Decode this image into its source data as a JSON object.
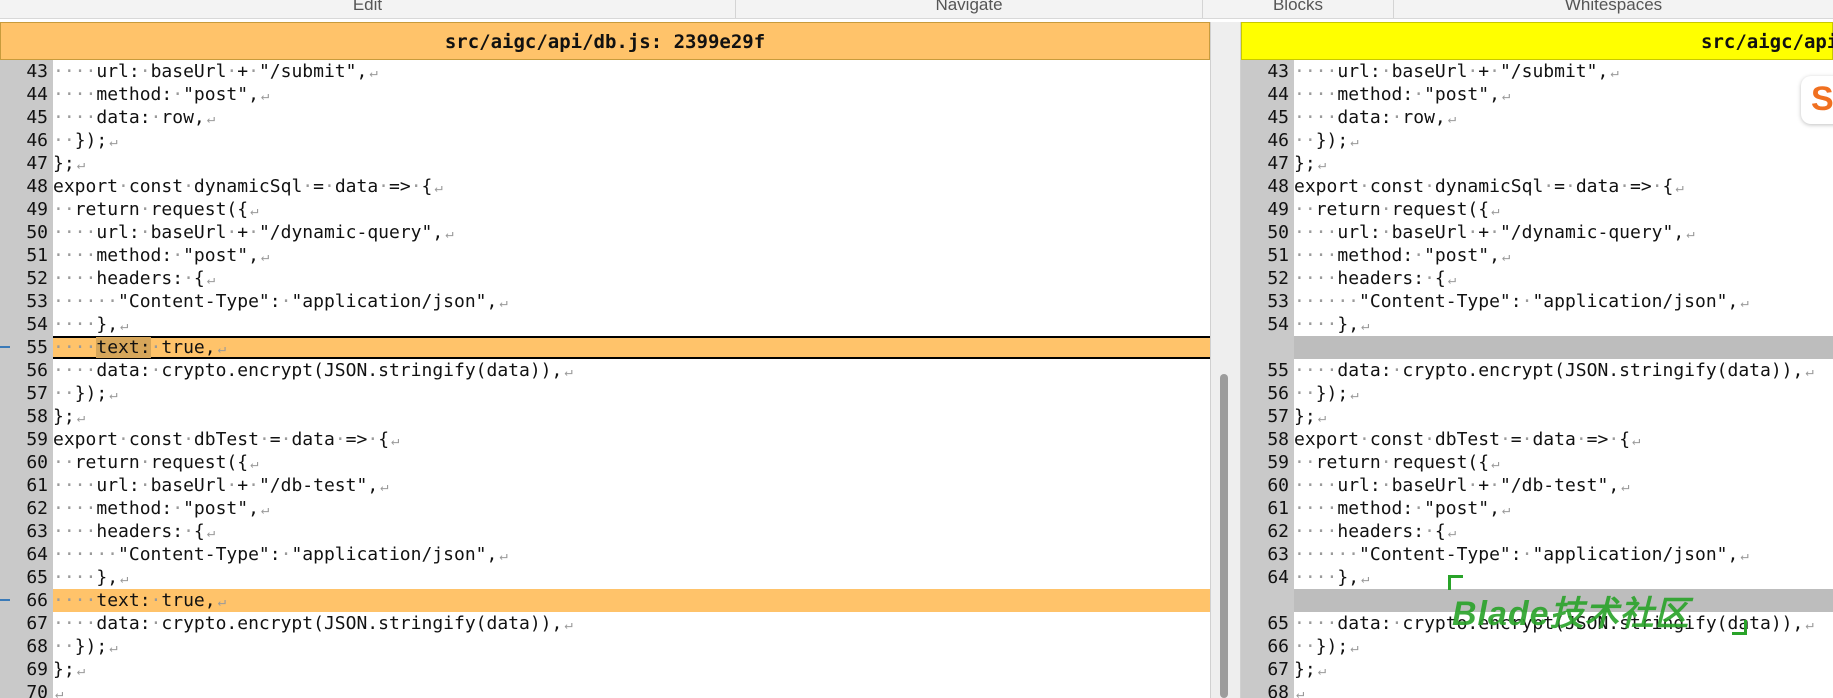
{
  "menu": [
    "Edit",
    "Navigate",
    "Blocks",
    "Whitespaces"
  ],
  "left_title": "src/aigc/api/db.js: 2399e29f",
  "right_title": "src/aigc/api",
  "watermark": "Blade技术社区",
  "logo_letter": "S",
  "colors": {
    "changed": "#ffc36a",
    "right_header": "#ffff00",
    "gutter": "#c9c9c9"
  },
  "left_lines": [
    {
      "n": "43",
      "t": "····url:·baseUrl·+·\"/submit\","
    },
    {
      "n": "44",
      "t": "····method:·\"post\","
    },
    {
      "n": "45",
      "t": "····data:·row,"
    },
    {
      "n": "46",
      "t": "··});"
    },
    {
      "n": "47",
      "t": "};"
    },
    {
      "n": "48",
      "t": "export·const·dynamicSql·=·data·=>·{"
    },
    {
      "n": "49",
      "t": "··return·request({"
    },
    {
      "n": "50",
      "t": "····url:·baseUrl·+·\"/dynamic-query\","
    },
    {
      "n": "51",
      "t": "····method:·\"post\","
    },
    {
      "n": "52",
      "t": "····headers:·{"
    },
    {
      "n": "53",
      "t": "······\"Content-Type\":·\"application/json\","
    },
    {
      "n": "54",
      "t": "····},"
    },
    {
      "n": "55",
      "t": "····text:·true,",
      "changed": true,
      "boxed": true
    },
    {
      "n": "56",
      "t": "····data:·crypto.encrypt(JSON.stringify(data)),"
    },
    {
      "n": "57",
      "t": "··});"
    },
    {
      "n": "58",
      "t": "};"
    },
    {
      "n": "59",
      "t": "export·const·dbTest·=·data·=>·{"
    },
    {
      "n": "60",
      "t": "··return·request({"
    },
    {
      "n": "61",
      "t": "····url:·baseUrl·+·\"/db-test\","
    },
    {
      "n": "62",
      "t": "····method:·\"post\","
    },
    {
      "n": "63",
      "t": "····headers:·{"
    },
    {
      "n": "64",
      "t": "······\"Content-Type\":·\"application/json\","
    },
    {
      "n": "65",
      "t": "····},"
    },
    {
      "n": "66",
      "t": "····text:·true,",
      "changed": true
    },
    {
      "n": "67",
      "t": "····data:·crypto.encrypt(JSON.stringify(data)),"
    },
    {
      "n": "68",
      "t": "··});"
    },
    {
      "n": "69",
      "t": "};"
    },
    {
      "n": "70",
      "t": ""
    }
  ],
  "right_lines": [
    {
      "n": "43",
      "t": "····url:·baseUrl·+·\"/submit\","
    },
    {
      "n": "44",
      "t": "····method:·\"post\","
    },
    {
      "n": "45",
      "t": "····data:·row,"
    },
    {
      "n": "46",
      "t": "··});"
    },
    {
      "n": "47",
      "t": "};"
    },
    {
      "n": "48",
      "t": "export·const·dynamicSql·=·data·=>·{"
    },
    {
      "n": "49",
      "t": "··return·request({"
    },
    {
      "n": "50",
      "t": "····url:·baseUrl·+·\"/dynamic-query\","
    },
    {
      "n": "51",
      "t": "····method:·\"post\","
    },
    {
      "n": "52",
      "t": "····headers:·{"
    },
    {
      "n": "53",
      "t": "······\"Content-Type\":·\"application/json\","
    },
    {
      "n": "54",
      "t": "····},"
    },
    {
      "gap": true
    },
    {
      "n": "55",
      "t": "····data:·crypto.encrypt(JSON.stringify(data)),"
    },
    {
      "n": "56",
      "t": "··});"
    },
    {
      "n": "57",
      "t": "};"
    },
    {
      "n": "58",
      "t": "export·const·dbTest·=·data·=>·{"
    },
    {
      "n": "59",
      "t": "··return·request({"
    },
    {
      "n": "60",
      "t": "····url:·baseUrl·+·\"/db-test\","
    },
    {
      "n": "61",
      "t": "····method:·\"post\","
    },
    {
      "n": "62",
      "t": "····headers:·{"
    },
    {
      "n": "63",
      "t": "······\"Content-Type\":·\"application/json\","
    },
    {
      "n": "64",
      "t": "····},"
    },
    {
      "gap": true
    },
    {
      "n": "65",
      "t": "····data:·crypto.encrypt(JSON.stringify(data)),"
    },
    {
      "n": "66",
      "t": "··});"
    },
    {
      "n": "67",
      "t": "};"
    },
    {
      "n": "68",
      "t": ""
    }
  ]
}
